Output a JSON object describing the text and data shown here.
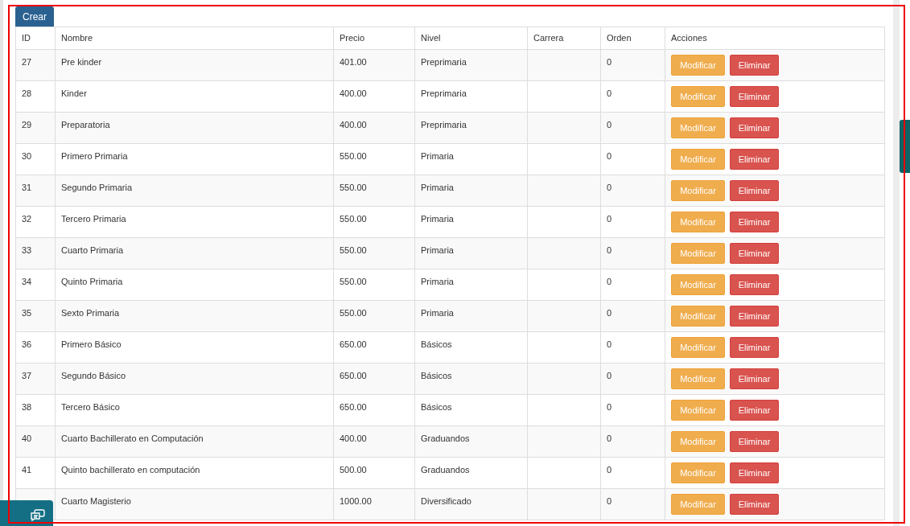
{
  "create_button": "Crear",
  "table": {
    "columns": [
      "ID",
      "Nombre",
      "Precio",
      "Nivel",
      "Carrera",
      "Orden",
      "Acciones"
    ],
    "rows": [
      {
        "id": "27",
        "nombre": "Pre kinder",
        "precio": "401.00",
        "nivel": "Preprimaria",
        "orden": "0",
        "actions": [
          "Modificar",
          "Eliminar"
        ]
      },
      {
        "id": "28",
        "nombre": "Kinder",
        "precio": "400.00",
        "nivel": "Preprimaria",
        "orden": "0",
        "actions": [
          "Modificar",
          "Eliminar"
        ]
      },
      {
        "id": "29",
        "nombre": "Preparatoria",
        "precio": "400.00",
        "nivel": "Preprimaria",
        "orden": "0",
        "actions": [
          "Modificar",
          "Eliminar"
        ]
      },
      {
        "id": "30",
        "nombre": "Primero Primaria",
        "precio": "550.00",
        "nivel": "Primaria",
        "orden": "0",
        "actions": [
          "Modificar",
          "Eliminar"
        ]
      },
      {
        "id": "31",
        "nombre": "Segundo Primaria",
        "precio": "550.00",
        "nivel": "Primaria",
        "orden": "0",
        "actions": [
          "Modificar",
          "Eliminar"
        ]
      },
      {
        "id": "32",
        "nombre": "Tercero Primaria",
        "precio": "550.00",
        "nivel": "Primaria",
        "orden": "0",
        "actions": [
          "Modificar",
          "Eliminar"
        ]
      },
      {
        "id": "33",
        "nombre": "Cuarto Primaria",
        "precio": "550.00",
        "nivel": "Primaria",
        "orden": "0",
        "actions": [
          "Modificar",
          "Eliminar"
        ]
      },
      {
        "id": "34",
        "nombre": "Quinto Primaria",
        "precio": "550.00",
        "nivel": "Primaria",
        "orden": "0",
        "actions": [
          "Modificar",
          "Eliminar"
        ]
      },
      {
        "id": "35",
        "nombre": "Sexto Primaria",
        "precio": "550.00",
        "nivel": "Primaria",
        "orden": "0",
        "actions": [
          "Modificar",
          "Eliminar"
        ]
      },
      {
        "id": "36",
        "nombre": "Primero Básico",
        "precio": "650.00",
        "nivel": "Básicos",
        "orden": "0",
        "actions": [
          "Modificar",
          "Eliminar"
        ]
      },
      {
        "id": "37",
        "nombre": "Segundo Básico",
        "precio": "650.00",
        "nivel": "Básicos",
        "orden": "0",
        "actions": [
          "Modificar",
          "Eliminar"
        ]
      },
      {
        "id": "38",
        "nombre": "Tercero Básico",
        "precio": "650.00",
        "nivel": "Básicos",
        "orden": "0",
        "actions": [
          "Modificar",
          "Eliminar"
        ]
      },
      {
        "id": "40",
        "nombre": "Cuarto Bachillerato en Computación",
        "precio": "400.00",
        "nivel": "Graduandos",
        "orden": "0",
        "actions": [
          "Modificar",
          "Eliminar"
        ]
      },
      {
        "id": "41",
        "nombre": "Quinto bachillerato en computación",
        "precio": "500.00",
        "nivel": "Graduandos",
        "orden": "0",
        "actions": [
          "Modificar",
          "Eliminar"
        ]
      },
      {
        "nombre": "Cuarto Magisterio",
        "precio": "1000.00",
        "nivel": "Diversificado",
        "orden": "0",
        "actions": [
          "Modificar",
          "Eliminar"
        ]
      }
    ]
  }
}
